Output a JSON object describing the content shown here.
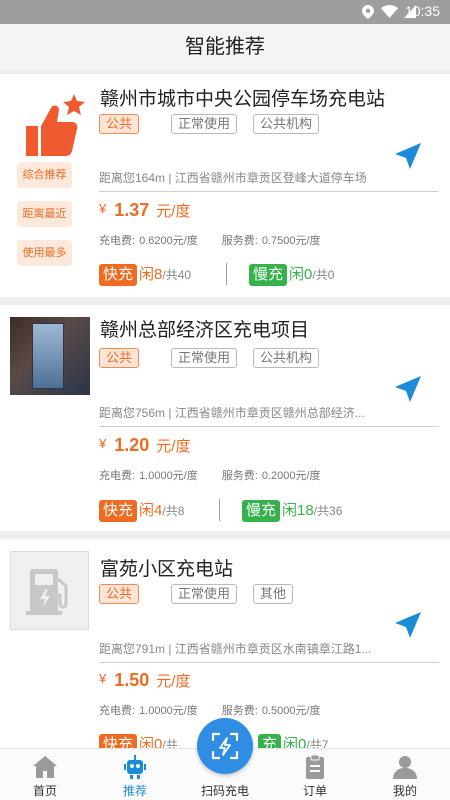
{
  "status": {
    "time": "10:35"
  },
  "header": {
    "title": "智能推荐"
  },
  "side_tags": [
    "综合推荐",
    "距离最近",
    "使用最多"
  ],
  "stations": [
    {
      "name": "赣州市城市中央公园停车场充电站",
      "chips": [
        "公共",
        "正常使用",
        "公共机构"
      ],
      "address": "距离您164m | 江西省赣州市章贡区登峰大道停车场",
      "yen": "¥",
      "price": "1.37",
      "price_unit": "元/度",
      "fee_label": "充电费:",
      "fee_value": "0.6200元/度",
      "service_label": "服务费:",
      "service_value": "0.7500元/度",
      "fast_label": "快充",
      "fast_idle": "闲8",
      "fast_total": "/共40",
      "slow_label": "慢充",
      "slow_idle": "闲0",
      "slow_total": "/共0"
    },
    {
      "name": "赣州总部经济区充电项目",
      "chips": [
        "公共",
        "正常使用",
        "公共机构"
      ],
      "address": "距离您756m | 江西省赣州市章贡区赣州总部经济...",
      "yen": "¥",
      "price": "1.20",
      "price_unit": "元/度",
      "fee_label": "充电费:",
      "fee_value": "1.0000元/度",
      "service_label": "服务费:",
      "service_value": "0.2000元/度",
      "fast_label": "快充",
      "fast_idle": "闲4",
      "fast_total": "/共8",
      "slow_label": "慢充",
      "slow_idle": "闲18",
      "slow_total": "/共36"
    },
    {
      "name": "富苑小区充电站",
      "chips": [
        "公共",
        "正常使用",
        "其他"
      ],
      "address": "距离您791m | 江西省赣州市章贡区水南镇章江路1...",
      "yen": "¥",
      "price": "1.50",
      "price_unit": "元/度",
      "fee_label": "充电费:",
      "fee_value": "1.0000元/度",
      "service_label": "服务费:",
      "service_value": "0.5000元/度",
      "fast_label": "快充",
      "fast_idle": "闲0",
      "fast_total": "/共",
      "slow_label": "充",
      "slow_idle": "闲0",
      "slow_total": "/共7"
    }
  ],
  "tabs": [
    "首页",
    "推荐",
    "扫码充电",
    "订单",
    "我的"
  ],
  "colors": {
    "accent": "#ef6b22",
    "slow": "#35b24a",
    "active_tab": "#1a8cd8",
    "scan_button": "#2f8de4"
  }
}
